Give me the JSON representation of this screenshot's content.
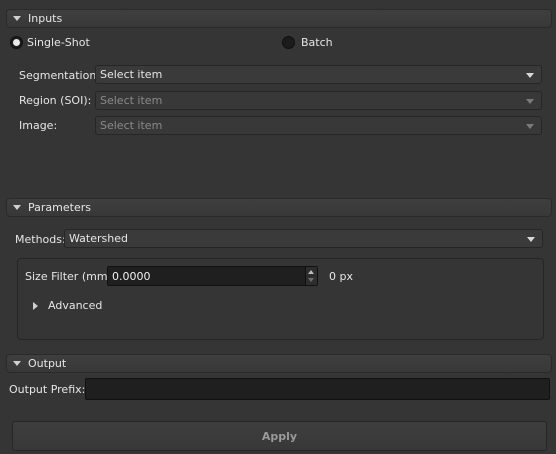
{
  "inputs": {
    "header": "Inputs",
    "mode": {
      "single_shot": "Single-Shot",
      "batch": "Batch",
      "selected": "single_shot"
    },
    "segmentation": {
      "label": "Segmentation:",
      "value": "Select item",
      "enabled": true
    },
    "region": {
      "label": "Region (SOI):",
      "value": "Select item",
      "enabled": false
    },
    "image": {
      "label": "Image:",
      "value": "Select item",
      "enabled": false
    }
  },
  "parameters": {
    "header": "Parameters",
    "methods": {
      "label": "Methods:",
      "value": "Watershed"
    },
    "size_filter": {
      "label": "Size Filter (mm):",
      "value": "0.0000",
      "px_text": "0 px"
    },
    "advanced": {
      "label": "Advanced",
      "expanded": false
    }
  },
  "output": {
    "header": "Output",
    "prefix": {
      "label": "Output Prefix:",
      "value": ""
    }
  },
  "apply": {
    "label": "Apply",
    "enabled": false
  },
  "colors": {
    "background": "#353535",
    "text": "#e6e6e6",
    "field_dark": "#1f1f1f"
  },
  "icons": [
    "collapse-arrow-icon",
    "expand-arrow-icon",
    "combo-arrow-icon",
    "spin-arrows-icon"
  ]
}
